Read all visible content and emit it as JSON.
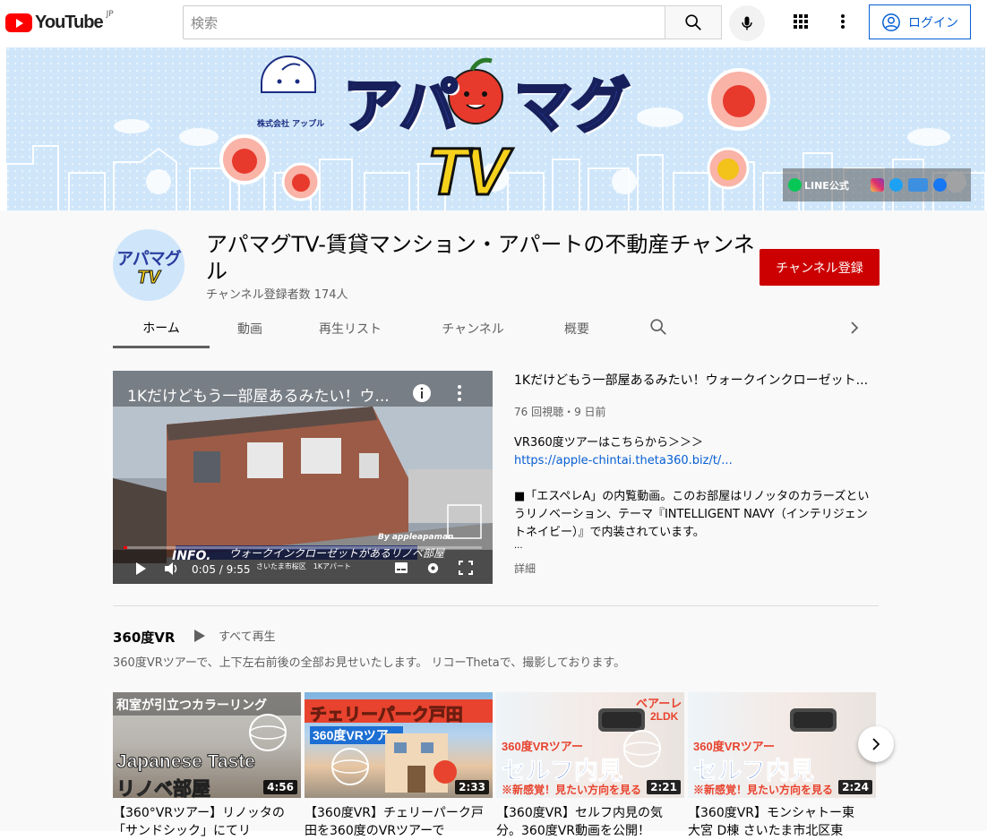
{
  "header": {
    "logo_text": "YouTube",
    "region": "JP",
    "search_placeholder": "検索",
    "login_label": "ログイン",
    "icons": [
      "youtube-logo",
      "search-icon",
      "mic-icon",
      "apps-icon",
      "more-vert-icon",
      "account-circle-icon"
    ]
  },
  "banner": {
    "title": "アパ",
    "title2": "マグ",
    "tv": "TV",
    "company": "株式会社 アップル",
    "line_label": "LINE公式",
    "social_icons": [
      "line-icon",
      "instagram-icon",
      "twitter-icon",
      "apple-icon",
      "facebook-icon"
    ]
  },
  "channel": {
    "name": "アパマグTV-賃貸マンション・アパートの不動産チャンネル",
    "subscribers": "チャンネル登録者数 174人",
    "subscribe_label": "チャンネル登録",
    "avatar_line1": "アパマグ",
    "avatar_line2": "TV"
  },
  "tabs": [
    "ホーム",
    "動画",
    "再生リスト",
    "チャンネル",
    "概要"
  ],
  "featured": {
    "player_title": "1Kだけどもう一部屋あるみたい！ウ...",
    "time": "0:05 / 9:55",
    "progress": 0.01,
    "overlay_by": "By appleapaman",
    "overlay_info": "INFO.",
    "overlay_caption": "ウォークインクローゼットがあるリノベ部屋",
    "overlay_sub": "さいたま市桜区　1Kアパート",
    "title": "1Kだけどもう一部屋あるみたい！ウォークインクローゼット...",
    "meta": "76 回視聴・9 日前",
    "desc_line1": "VR360度ツアーはこちらから＞＞＞",
    "desc_link": "https://apple-chintai.theta360.biz/t/...",
    "desc_line2": "■「エスペレA」の内覧動画。このお部屋はリノッタのカラーズというリノベーション、テーマ『INTELLIGENT NAVY（インテリジェントネイビー）』で内装されています。",
    "desc_ellipsis": "...",
    "more_label": "詳細"
  },
  "shelf": {
    "title": "360度VR",
    "play_all": "すべて再生",
    "description": "360度VRツアーで、上下左右前後の全部お見せいたします。 リコーThetaで、撮影しております。",
    "videos": [
      {
        "duration": "4:56",
        "title": "【360°VRツアー】リノッタの「サンドシック」にてリ",
        "thumb_top": "和室が引立つカラーリング",
        "thumb_mid": "Japanese Taste",
        "thumb_bot": "リノベ部屋"
      },
      {
        "duration": "2:33",
        "title": "【360度VR】チェリーパーク戸田を360度のVRツアーで",
        "thumb_top": "チェリーパーク戸田",
        "thumb_mid": "360度VRツアー",
        "thumb_bot": ""
      },
      {
        "duration": "2:21",
        "title": "【360度VR】セルフ内見の気分。360度VR動画を公開！",
        "thumb_top": "ベアーレ",
        "thumb_mid": "360度VRツアー",
        "thumb_bot": "セルフ内見",
        "thumb_sub": "※新感覚！見たい方向を見る",
        "thumb_extra": "2LDK"
      },
      {
        "duration": "2:24",
        "title": "【360度VR】モンシャトー東大宮 D棟 さいたま市北区東",
        "thumb_top": "",
        "thumb_mid": "360度VRツアー",
        "thumb_bot": "セルフ内見",
        "thumb_sub": "※新感覚！見たい方向を見る"
      }
    ]
  }
}
